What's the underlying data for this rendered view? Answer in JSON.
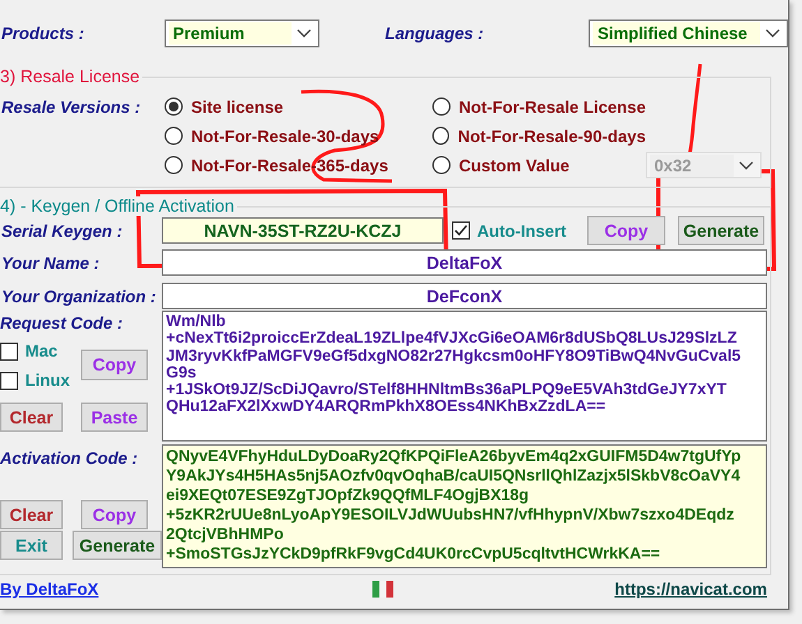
{
  "products": {
    "label": "Products :",
    "value": "Premium"
  },
  "languages": {
    "label": "Languages :",
    "value": "Simplified Chinese"
  },
  "resale": {
    "title": "3) Resale License",
    "label": "Resale Versions :",
    "options": [
      {
        "label": "Site license",
        "selected": true
      },
      {
        "label": "Not-For-Resale License",
        "selected": false
      },
      {
        "label": "Not-For-Resale-30-days",
        "selected": false
      },
      {
        "label": "Not-For-Resale-90-days",
        "selected": false
      },
      {
        "label": "Not-For-Resale-365-days",
        "selected": false
      },
      {
        "label": "Custom Value",
        "selected": false
      }
    ],
    "custom_value": {
      "value": "0x32",
      "disabled": true
    }
  },
  "keygen": {
    "title": "4) - Keygen / Offline Activation",
    "serial": {
      "label": "Serial Keygen :",
      "value": "NAVN-35ST-RZ2U-KCZJ"
    },
    "auto_insert": {
      "label": "Auto-Insert",
      "checked": true
    },
    "serial_buttons": [
      "Copy",
      "Generate"
    ],
    "name": {
      "label": "Your Name :",
      "value": "DeltaFoX"
    },
    "organization": {
      "label": "Your Organization :",
      "value": "DeFconX"
    },
    "request": {
      "label": "Request Code :",
      "mac": {
        "label": "Mac",
        "checked": false
      },
      "linux": {
        "label": "Linux",
        "checked": false
      },
      "buttons": [
        "Copy",
        "Clear",
        "Paste"
      ],
      "lines": [
        "Wm/Nlb",
        "+cNexTt6i2proiccErZdeaL19ZLlpe4fVJXcGi6eOAM6r8dUSbQ8LUsJ29SlzLZ",
        "JM3ryvKkfPaMGFV9eGf5dxgNO82r27Hgkcsm0oHFY8O9TiBwQ4NvGuCval5",
        "G9s",
        "+1JSkOt9JZ/ScDiJQavro/STelf8HHNltmBs36aPLPQ9eE5VAh3tdGeJY7xYT",
        "QHu12aFX2lXxwDY4ARQRmPkhX8OEss4NKhBxZzdLA=="
      ]
    },
    "activation": {
      "label": "Activation Code :",
      "buttons": [
        "Clear",
        "Copy",
        "Exit",
        "Generate"
      ],
      "lines": [
        "QNyvE4VFhyHduLDyDoaRy2QfKPQiFleA26byvEm4q2xGUIFM5D4w7tgUfYp",
        "Y9AkJYs4H5HAs5nj5AOzfv0qvOqhaB/caUI5QNsrllQhlZazjx5lSkbV8cOaVY4",
        "ei9XEQt07ESE9ZgTJOpfZk9QQfMLF4OgjBX18g",
        "+5zKR2rUUe8nLyoApY9ESOILVJdWUubsHN7/vfHhypnV/Xbw7szxo4DEqdz",
        "2QtcjVBhHMPo",
        "+SmoSTGsJzYCkD9pfRkF9vgCd4UK0rcCvpU5cqltvtHCWrkKA=="
      ]
    }
  },
  "footer": {
    "author": "By DeltaFoX",
    "url": "https://navicat.com"
  }
}
